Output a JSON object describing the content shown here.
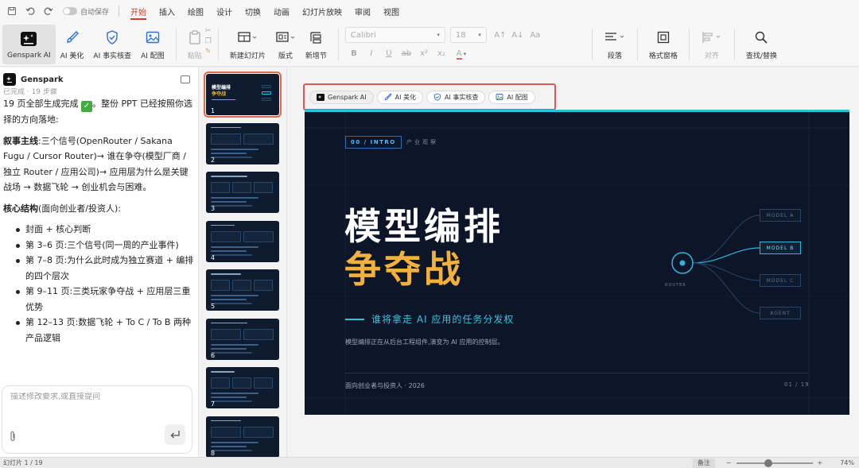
{
  "tabbar": {
    "autosave_label": "自动保存",
    "tabs": [
      "开始",
      "插入",
      "绘图",
      "设计",
      "切换",
      "动画",
      "幻灯片放映",
      "审阅",
      "视图"
    ],
    "active_tab": "开始"
  },
  "ribbon": {
    "genspark_ai": "Genspark AI",
    "ai_beautify": "AI 美化",
    "ai_factcheck": "AI 事实核查",
    "ai_image": "AI 配图",
    "paste": "粘贴",
    "new_slide": "新建幻灯片",
    "layout": "版式",
    "new_section": "新增节",
    "font_name": "Calibri",
    "font_size": "18",
    "paragraph": "段落",
    "format_pane": "格式窗格",
    "align": "对齐",
    "find_replace": "查找/替换",
    "accent_color": "#d43c2c"
  },
  "leftpanel": {
    "title": "Genspark",
    "faded_text": "已完成 · 19 步骤",
    "p1_prefix": "19 页全部生成完成",
    "p1_suffix": "。整份 PPT 已经按照你选择的方向落地:",
    "p2_bold": "叙事主线",
    "p2_text": ":三个信号(OpenRouter / Sakana Fugu / Cursor Router)→ 谁在争夺(模型厂商 / 独立 Router / 应用公司)→ 应用层为什么是关键战场 → 数据飞轮 → 创业机会与困难。",
    "p3_bold": "核心结构",
    "p3_text": "(面向创业者/投资人):",
    "list": [
      "封面 + 核心判断",
      "第 3–6 页:三个信号(同一周的产业事件)",
      "第 7–8 页:为什么此时成为独立赛道 + 编排的四个层次",
      "第 9–11 页:三类玩家争夺战 + 应用层三重优势",
      "第 12–13 页:数据飞轮 + To C / To B 两种产品逻辑"
    ],
    "input_placeholder": "描述修改要求,或直接提问"
  },
  "thumbnails": [
    {
      "num": "1"
    },
    {
      "num": "2"
    },
    {
      "num": "3"
    },
    {
      "num": "4"
    },
    {
      "num": "5"
    },
    {
      "num": "6"
    },
    {
      "num": "7"
    },
    {
      "num": "8"
    }
  ],
  "thumb1": {
    "title1": "模型编排",
    "title2": "争夺战"
  },
  "ai_toolbar": {
    "genspark_ai": "Genspark AI",
    "ai_beautify": "AI 美化",
    "ai_factcheck": "AI 事实核查",
    "ai_image": "AI 配图"
  },
  "slide": {
    "intro_tag": "00 / INTRO",
    "intro_sub": "产业观察",
    "title_line1": "模型编排",
    "title_line2": "争夺战",
    "subtitle": "谁将拿走 AI 应用的任务分发权",
    "description": "模型编排正在从后台工程组件,演变为 AI 应用的控制层。",
    "footer_left": "面向创业者与投资人 · 2026",
    "footer_right": "01 / 19",
    "router_label": "ROUTER",
    "models": [
      "MODEL A",
      "MODEL B",
      "MODEL C",
      "AGENT"
    ],
    "active_model": "MODEL B",
    "bg_color": "#0c1628",
    "accent_cyan": "#22c7d9",
    "accent_gold": "#f2b13c"
  },
  "statusbar": {
    "slide_info": "幻灯片 1 / 19",
    "notes": "备注",
    "zoom_minus": "−",
    "zoom_plus": "+",
    "zoom_level": "74%",
    "zoom_fraction": 0.42
  }
}
